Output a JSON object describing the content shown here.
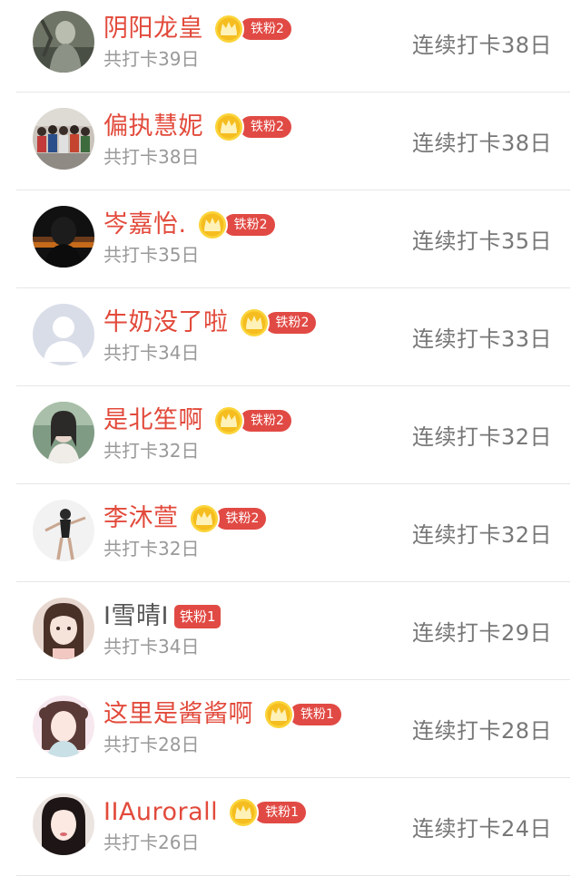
{
  "users": [
    {
      "name": "阴阳龙皇",
      "name_color": "red",
      "badge_type": "crown",
      "badge": "铁粉2",
      "total": "共打卡39日",
      "streak": "连续打卡38日",
      "avatar": "gray-figure"
    },
    {
      "name": "偏执慧妮",
      "name_color": "red",
      "badge_type": "crown",
      "badge": "铁粉2",
      "total": "共打卡38日",
      "streak": "连续打卡38日",
      "avatar": "group-photo"
    },
    {
      "name": "岑嘉怡.",
      "name_color": "red",
      "badge_type": "crown",
      "badge": "铁粉2",
      "total": "共打卡35日",
      "streak": "连续打卡35日",
      "avatar": "dark-night"
    },
    {
      "name": "牛奶没了啦",
      "name_color": "red",
      "badge_type": "crown",
      "badge": "铁粉2",
      "total": "共打卡34日",
      "streak": "连续打卡33日",
      "avatar": "default-person"
    },
    {
      "name": "是北笙啊",
      "name_color": "red",
      "badge_type": "crown",
      "badge": "铁粉2",
      "total": "共打卡32日",
      "streak": "连续打卡32日",
      "avatar": "green-girl"
    },
    {
      "name": "李沐萱",
      "name_color": "red",
      "badge_type": "crown",
      "badge": "铁粉2",
      "total": "共打卡32日",
      "streak": "连续打卡32日",
      "avatar": "dancer"
    },
    {
      "name": "I雪晴I",
      "name_color": "gray",
      "badge_type": "plain",
      "badge": "铁粉1",
      "total": "共打卡34日",
      "streak": "连续打卡29日",
      "avatar": "girl-light"
    },
    {
      "name": "这里是酱酱啊",
      "name_color": "red",
      "badge_type": "crown",
      "badge": "铁粉1",
      "total": "共打卡28日",
      "streak": "连续打卡28日",
      "avatar": "girl-pink"
    },
    {
      "name": "IIAurorall",
      "name_color": "red",
      "badge_type": "crown",
      "badge": "铁粉1",
      "total": "共打卡26日",
      "streak": "连续打卡24日",
      "avatar": "girl-dark-hair"
    }
  ],
  "colors": {
    "name_red": "#e24a3b",
    "badge_red": "#e14a44",
    "coin_gold": "#f7c325",
    "divider": "#e6e6e6"
  }
}
